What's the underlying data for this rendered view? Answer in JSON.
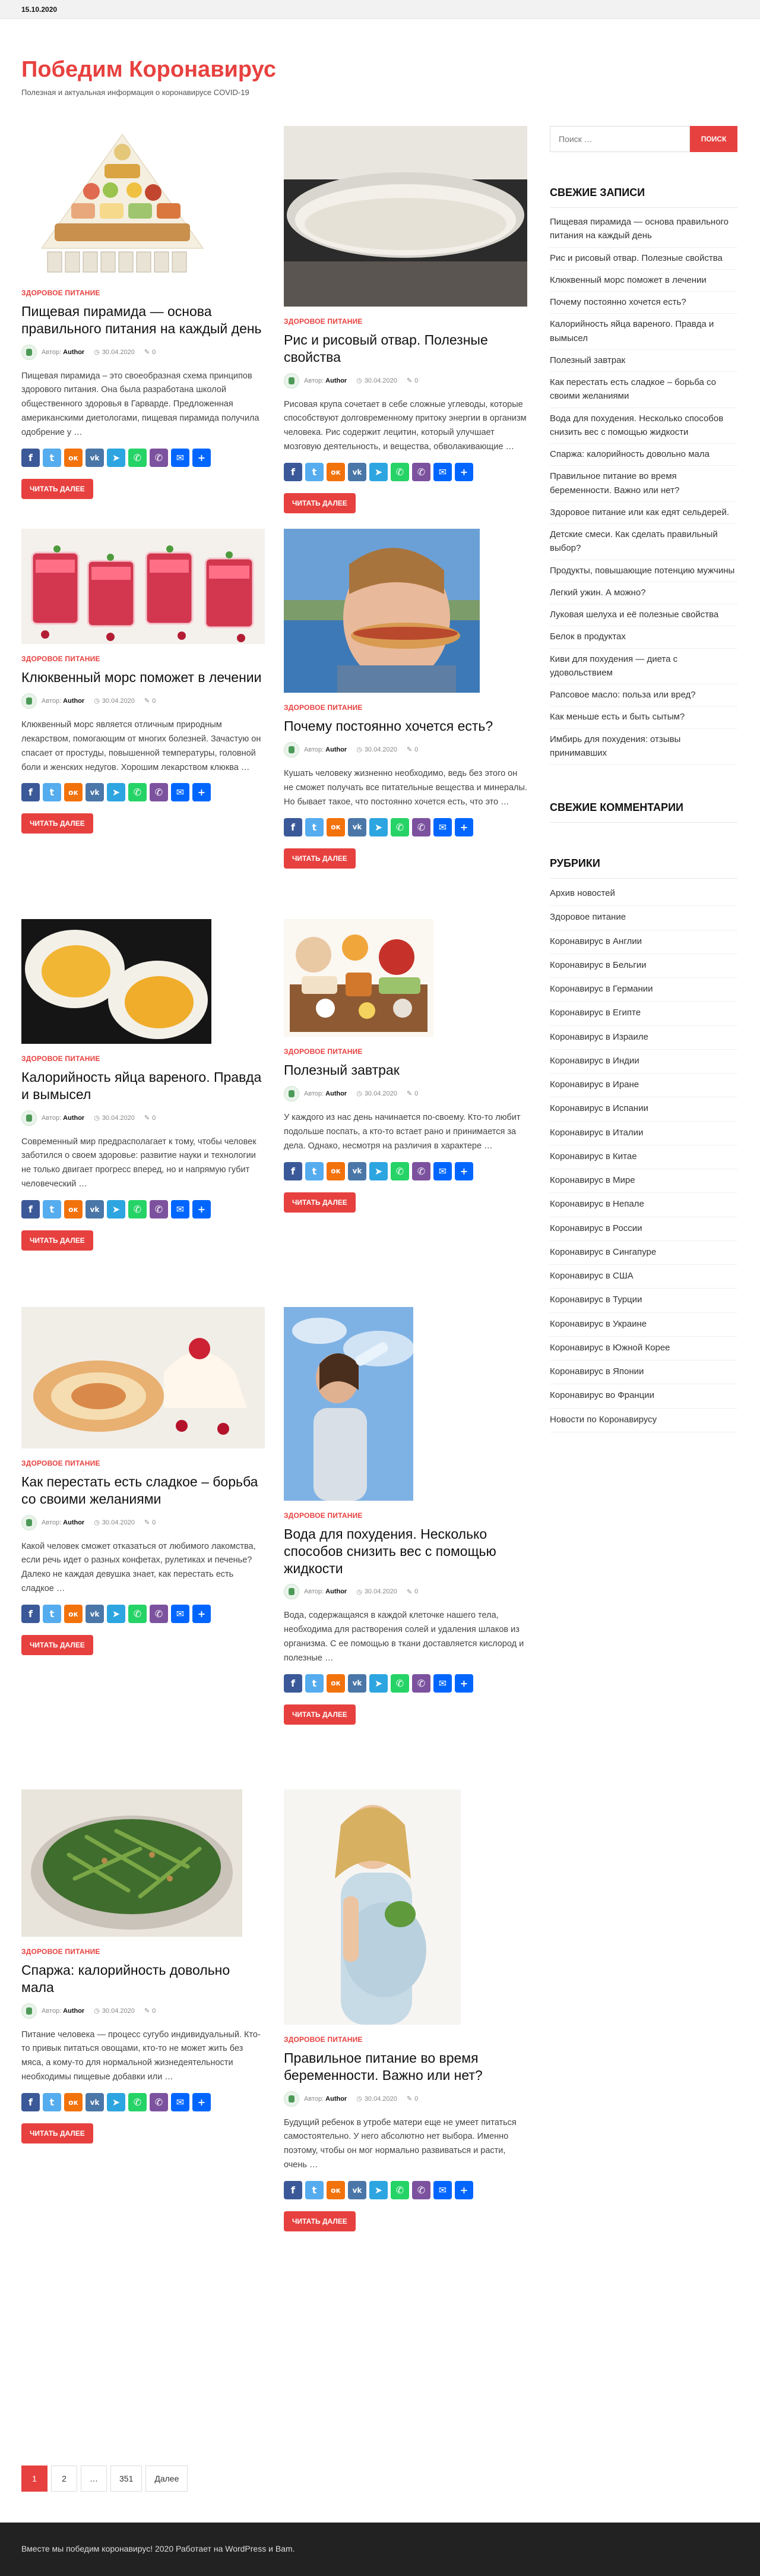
{
  "topbar": {
    "date": "15.10.2020"
  },
  "site": {
    "title": "Победим Коронавирус",
    "description": "Полезная и актуальная информация о коронавирусе COVID-19"
  },
  "colors": {
    "accent": "#e7413f",
    "footer_bg": "#222222"
  },
  "post_labels": {
    "author_prefix": "Автор:",
    "author": "Author",
    "date": "30.04.2020",
    "comments": "0",
    "read_more": "ЧИТАТЬ ДАЛЕЕ",
    "category": "ЗДОРОВОЕ ПИТАНИЕ"
  },
  "posts": [
    {
      "title": "Пищевая пирамида — основа правильного питания на каждый день",
      "excerpt": "Пищевая пирамида – это своеобразная схема принципов здорового питания. Она была разработана школой общественного здоровья в Гарварде. Предложенная американскими диетологами, пищевая пирамида получила одобрение у …",
      "image": "food-pyramid-image"
    },
    {
      "title": "Рис и рисовый отвар. Полезные свойства",
      "excerpt": "Рисовая крупа сочетает в себе сложные углеводы, которые способствуют долговременному притоку энергии в организм человека. Рис содержит лецитин, который улучшает мозговую деятельность, и вещества, обволакивающие …",
      "image": "rice-water-image"
    },
    {
      "title": "Клюквенный морс поможет в лечении",
      "excerpt": "Клюквенный морс является отличным природным лекарством, помогающим от многих болезней. Зачастую он спасает от простуды, повышенной температуры, головной боли и женских недугов. Хорошим лекарством клюква …",
      "image": "cranberry-drink-image"
    },
    {
      "title": "Почему постоянно хочется есть?",
      "excerpt": "Кушать человеку жизненно необходимо, ведь без этого он не сможет получать все питательные вещества и минералы. Но бывает такое, что постоянно хочется есть, что это …",
      "image": "boy-hotdog-image"
    },
    {
      "title": "Калорийность яйца вареного. Правда и вымысел",
      "excerpt": "Современный мир предрасполагает к тому, чтобы человек заботился о своем здоровье: развитие науки и технологии не только двигает прогресс вперед, но и напрямую губит человеческий …",
      "image": "boiled-eggs-image"
    },
    {
      "title": "Полезный завтрак",
      "excerpt": "У каждого из нас день начинается по-своему. Кто-то любит подольше поспать, а кто-то встает рано и принимается за дела. Однако, несмотря на различия в характере …",
      "image": "breakfast-table-image"
    },
    {
      "title": "Как перестать есть сладкое – борьба со своими желаниями",
      "excerpt": "Какой человек сможет отказаться от любимого лакомства, если речь идет о разных конфетах, рулетиках и печенье? Далеко не каждая девушка знает, как перестать есть сладкое …",
      "image": "cake-roll-image"
    },
    {
      "title": "Вода для похудения. Несколько способов снизить вес с помощью жидкости",
      "excerpt": "Вода, содержащаяся в каждой клеточке нашего тела, необходима для растворения солей и удаления шлаков из организма. С ее помощью в ткани доставляется кислород и полезные …",
      "image": "woman-drinking-water-image"
    },
    {
      "title": "Спаржа: калорийность довольно мала",
      "excerpt": "Питание человека — процесс сугубо индивидуальный. Кто-то привык питаться овощами, кто-то не может жить без мяса, а кому-то для нормальной жизнедеятельности необходимы пищевые добавки или …",
      "image": "asparagus-image"
    },
    {
      "title": "Правильное питание во время беременности. Важно или нет?",
      "excerpt": "Будущий ребенок в утробе матери еще не умеет питаться самостоятельно. У него абсолютно нет выбора. Именно поэтому, чтобы он мог нормально развиваться и расти, очень …",
      "image": "pregnant-woman-image"
    }
  ],
  "share_buttons": [
    {
      "name": "facebook",
      "color": "#3b5998",
      "glyph": "f"
    },
    {
      "name": "twitter",
      "color": "#55acee",
      "glyph": "t"
    },
    {
      "name": "odnoklassniki",
      "color": "#f2720c",
      "glyph": "ок"
    },
    {
      "name": "vkontakte",
      "color": "#4a76a8",
      "glyph": "vk"
    },
    {
      "name": "telegram",
      "color": "#2ca5e0",
      "glyph": "➤"
    },
    {
      "name": "whatsapp",
      "color": "#25d366",
      "glyph": "✆"
    },
    {
      "name": "viber",
      "color": "#7c529e",
      "glyph": "✆"
    },
    {
      "name": "email",
      "color": "#0166ff",
      "glyph": "✉"
    },
    {
      "name": "share",
      "color": "#0166ff",
      "glyph": "+"
    }
  ],
  "sidebar": {
    "search": {
      "placeholder": "Поиск …",
      "button": "ПОИСК"
    },
    "recent_title": "СВЕЖИЕ ЗАПИСИ",
    "recent": [
      "Пищевая пирамида — основа правильного питания на каждый день",
      "Рис и рисовый отвар. Полезные свойства",
      "Клюквенный морс поможет в лечении",
      "Почему постоянно хочется есть?",
      "Калорийность яйца вареного. Правда и вымысел",
      "Полезный завтрак",
      "Как перестать есть сладкое – борьба со своими желаниями",
      "Вода для похудения. Несколько способов снизить вес с помощью жидкости",
      "Спаржа: калорийность довольно мала",
      "Правильное питание во время беременности. Важно или нет?",
      "Здоровое питание или как едят сельдерей.",
      "Детские смеси. Как сделать правильный выбор?",
      "Продукты, повышающие потенцию мужчины",
      "Легкий ужин. А можно?",
      "Луковая шелуха и её полезные свойства",
      "Белок в продуктах",
      "Киви для похудения — диета с удовольствием",
      "Рапсовое масло: польза или вред?",
      "Как меньше есть и быть сытым?",
      "Имбирь для похудения: отзывы принимавших"
    ],
    "comments_title": "СВЕЖИЕ КОММЕНТАРИИ",
    "categories_title": "РУБРИКИ",
    "categories": [
      "Архив новостей",
      "Здоровое питание",
      "Коронавирус в Англии",
      "Коронавирус в Бельгии",
      "Коронавирус в Германии",
      "Коронавирус в Египте",
      "Коронавирус в Израиле",
      "Коронавирус в Индии",
      "Коронавирус в Иране",
      "Коронавирус в Испании",
      "Коронавирус в Италии",
      "Коронавирус в Китае",
      "Коронавирус в Мире",
      "Коронавирус в Непале",
      "Коронавирус в России",
      "Коронавирус в Сингапуре",
      "Коронавирус в США",
      "Коронавирус в Турции",
      "Коронавирус в Украине",
      "Коронавирус в Южной Корее",
      "Коронавирус в Японии",
      "Коронавирус во Франции",
      "Новости по Коронавирусу"
    ]
  },
  "pagination": {
    "pages": [
      "1",
      "2",
      "…",
      "351"
    ],
    "current": "1",
    "next": "Далее"
  },
  "footer": {
    "text": "Вместе мы победим коронавирус! 2020 Работает на WordPress и Bam."
  }
}
